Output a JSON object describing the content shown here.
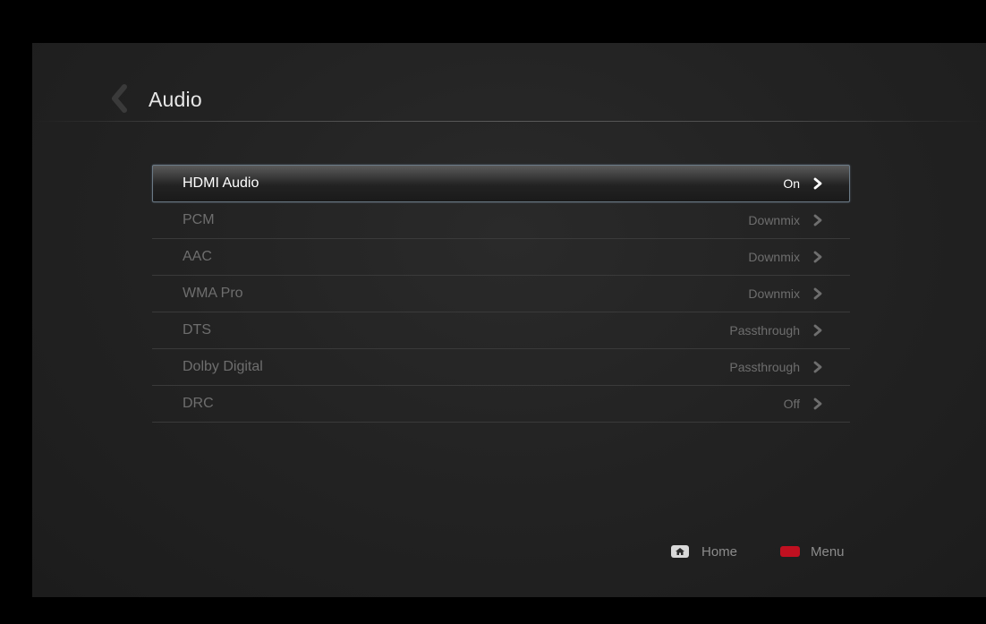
{
  "header": {
    "title": "Audio"
  },
  "menu": {
    "items": [
      {
        "label": "HDMI Audio",
        "value": "On",
        "selected": true
      },
      {
        "label": "PCM",
        "value": "Downmix",
        "selected": false
      },
      {
        "label": "AAC",
        "value": "Downmix",
        "selected": false
      },
      {
        "label": "WMA Pro",
        "value": "Downmix",
        "selected": false
      },
      {
        "label": "DTS",
        "value": "Passthrough",
        "selected": false
      },
      {
        "label": "Dolby Digital",
        "value": "Passthrough",
        "selected": false
      },
      {
        "label": "DRC",
        "value": "Off",
        "selected": false
      }
    ]
  },
  "footer": {
    "home_label": "Home",
    "menu_label": "Menu",
    "home_icon": "home-icon",
    "menu_icon": "red-button-icon"
  },
  "colors": {
    "background": "#232323",
    "selected_border": "#6b7a86",
    "menu_button": "#c01020",
    "text_active": "#ffffff",
    "text_inactive": "#6e6e6e"
  }
}
